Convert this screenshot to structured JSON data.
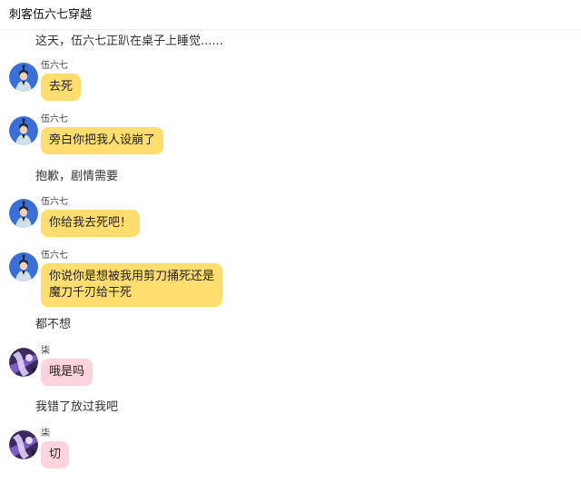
{
  "header": {
    "title": "刺客伍六七穿越"
  },
  "narration": {
    "n1": "这天，伍六七正趴在桌子上睡觉......",
    "n2": "抱歉，剧情需要",
    "n3": "都不想",
    "n4": "我错了放过我吧"
  },
  "messages": [
    {
      "sender": "伍六七",
      "text": "去死",
      "avatar": "wuliuqi-avatar"
    },
    {
      "sender": "伍六七",
      "text": "旁白你把我人设崩了",
      "avatar": "wuliuqi-avatar"
    },
    {
      "sender": "伍六七",
      "text": "你给我去死吧！",
      "avatar": "wuliuqi-avatar"
    },
    {
      "sender": "伍六七",
      "line1": "你说你是想被我用剪刀捅死还是",
      "line2": "魔刀千刃给干死",
      "avatar": "wuliuqi-avatar"
    },
    {
      "sender": "柒",
      "text": "哦是吗",
      "avatar": "qi-avatar"
    },
    {
      "sender": "柒",
      "text": "切",
      "avatar": "qi-avatar"
    }
  ],
  "colors": {
    "wuliuqi_bubble": "#ffdd6e",
    "qi_bubble": "#fdd3dd",
    "wuliuqi_avatar_bg": "#3a6fd8"
  }
}
